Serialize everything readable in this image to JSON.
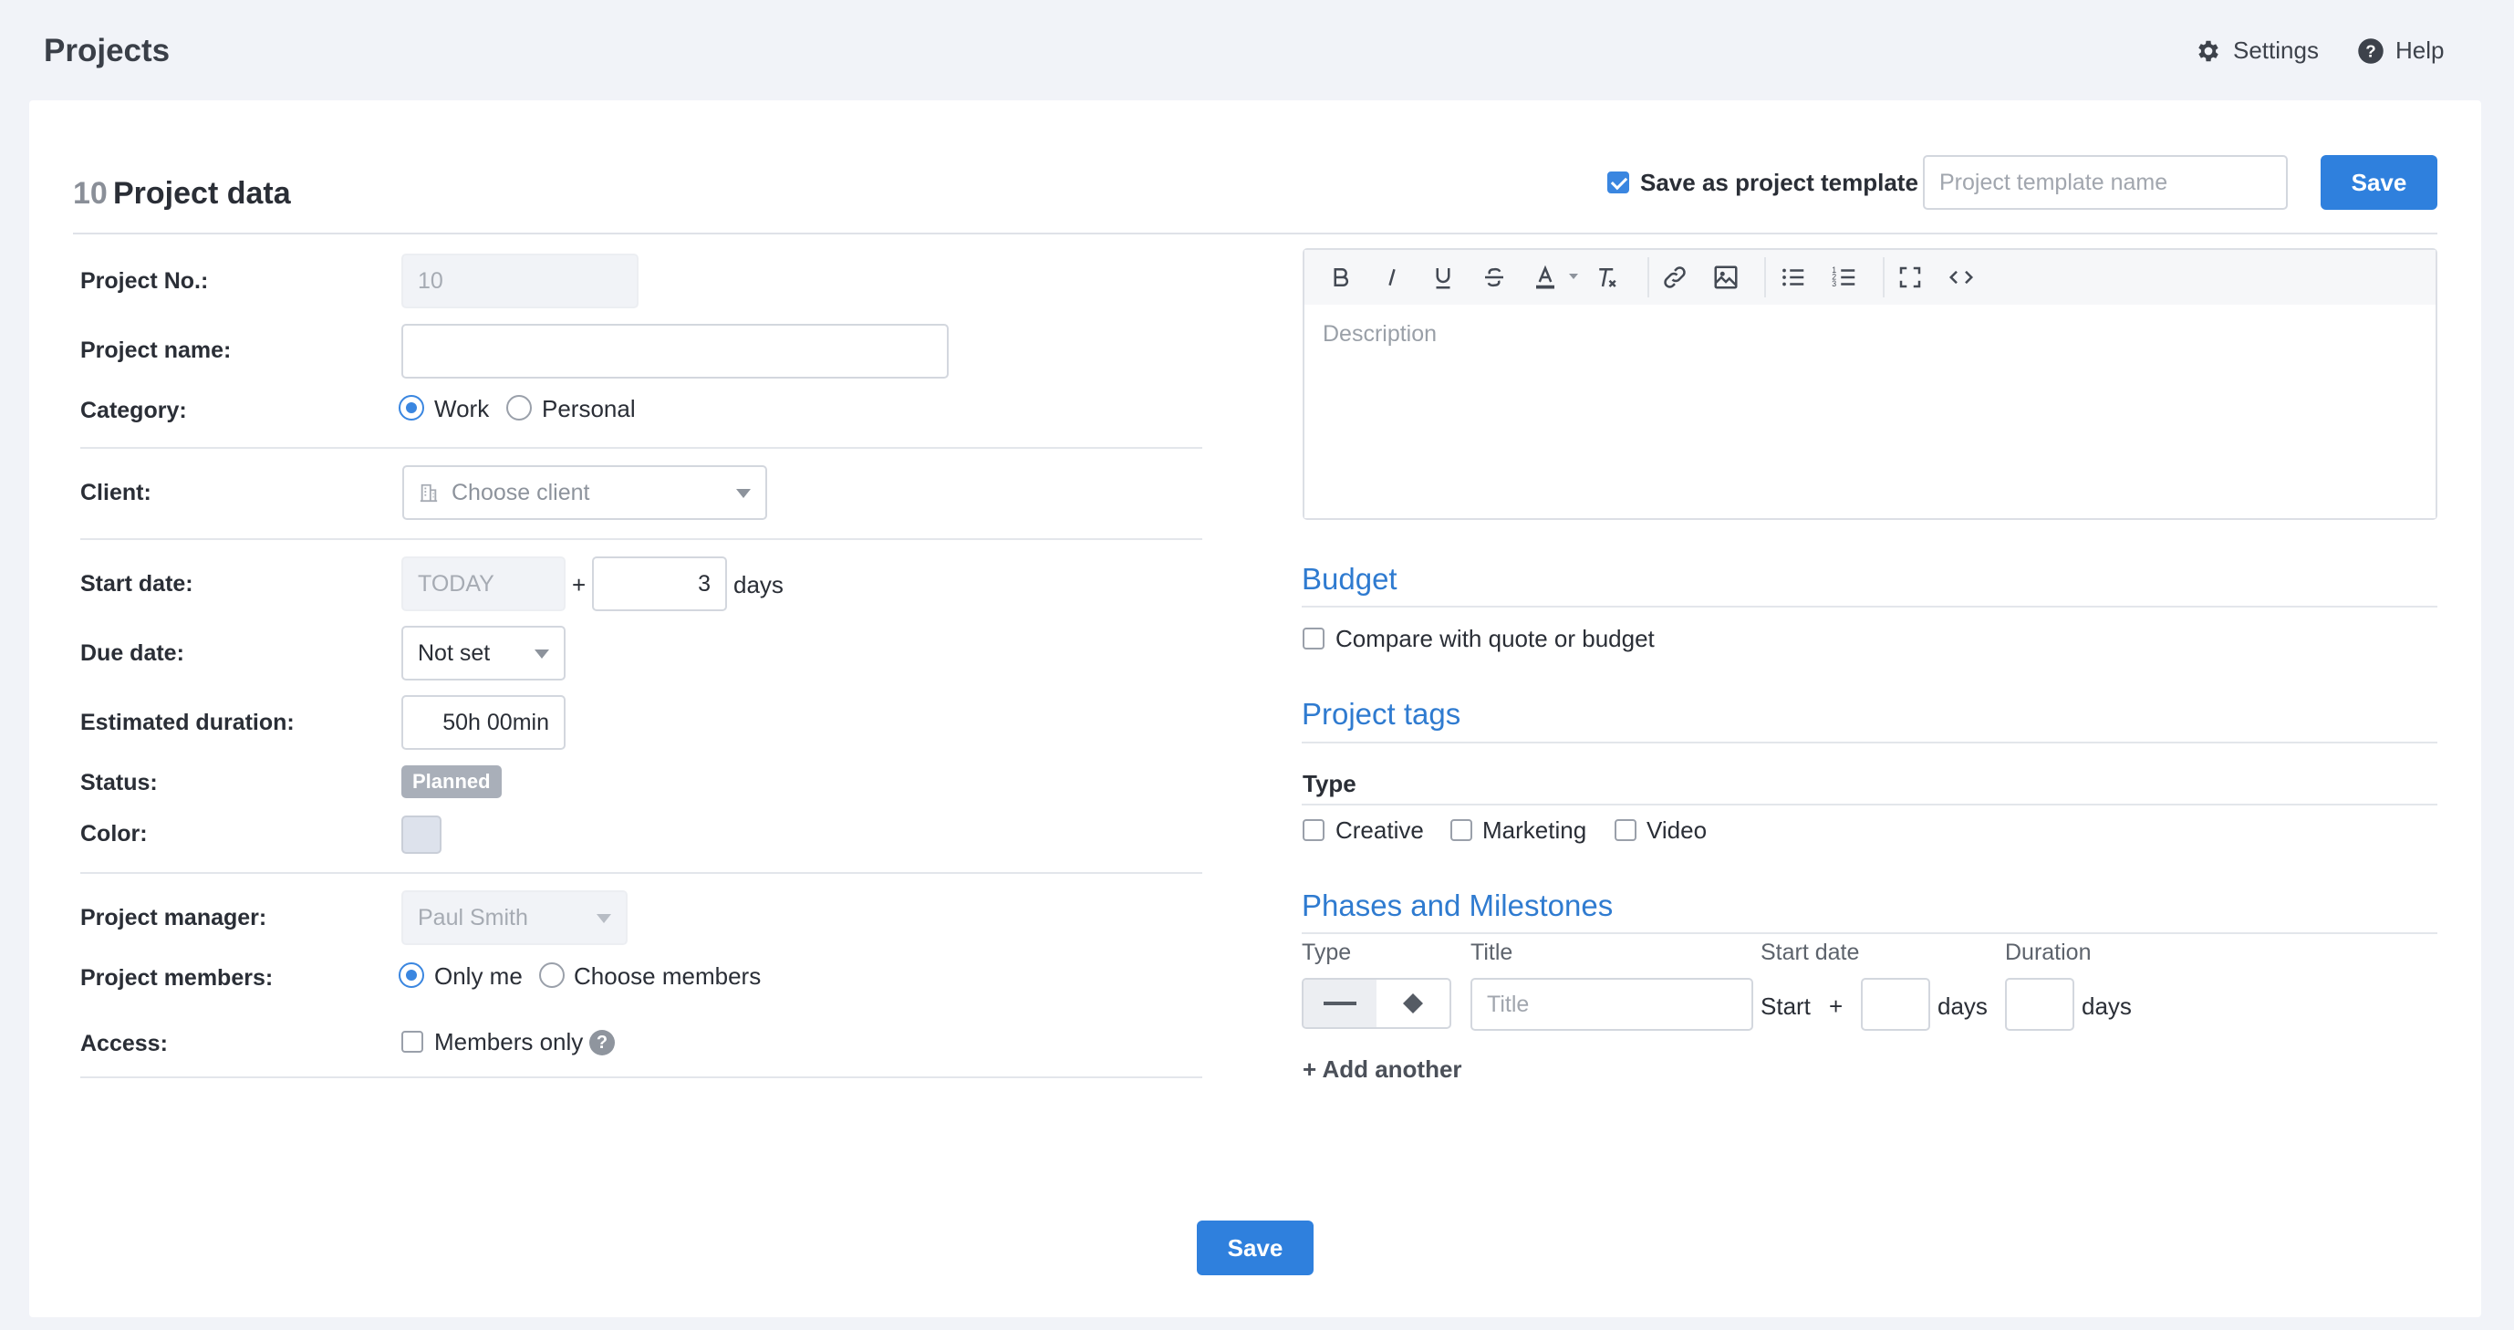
{
  "app": {
    "title": "Projects",
    "settings_label": "Settings",
    "help_label": "Help"
  },
  "header": {
    "count": "10",
    "title": "Project data",
    "save_template_label": "Save as project template",
    "save_template_checked": true,
    "template_name_placeholder": "Project template name",
    "save_label": "Save"
  },
  "form": {
    "project_no": {
      "label": "Project No.:",
      "value": "10"
    },
    "project_name": {
      "label": "Project name:",
      "value": ""
    },
    "category": {
      "label": "Category:",
      "options": [
        "Work",
        "Personal"
      ],
      "selected": "Work"
    },
    "client": {
      "label": "Client:",
      "placeholder": "Choose client",
      "icon": "building-icon"
    },
    "start_date": {
      "label": "Start date:",
      "base": "TODAY",
      "plus": "+",
      "offset": "3",
      "unit": "days"
    },
    "due_date": {
      "label": "Due date:",
      "value": "Not set"
    },
    "estimated_duration": {
      "label": "Estimated duration:",
      "value": "50h 00min"
    },
    "status": {
      "label": "Status:",
      "value": "Planned"
    },
    "color": {
      "label": "Color:",
      "value": "#dde2ec"
    },
    "project_manager": {
      "label": "Project manager:",
      "value": "Paul Smith"
    },
    "project_members": {
      "label": "Project members:",
      "options": [
        "Only me",
        "Choose members"
      ],
      "selected": "Only me"
    },
    "access": {
      "label": "Access:",
      "option": "Members only",
      "checked": false,
      "help": "?"
    }
  },
  "description": {
    "placeholder": "Description",
    "toolbar": [
      "bold-icon",
      "italic-icon",
      "underline-icon",
      "strikethrough-icon",
      "text-color-icon",
      "clear-format-icon",
      "link-icon",
      "image-icon",
      "bullet-list-icon",
      "numbered-list-icon",
      "fullscreen-icon",
      "code-view-icon"
    ]
  },
  "budget": {
    "title": "Budget",
    "compare_label": "Compare with quote or budget",
    "compare_checked": false
  },
  "tags": {
    "title": "Project tags",
    "type_label": "Type",
    "options": [
      {
        "label": "Creative",
        "checked": false
      },
      {
        "label": "Marketing",
        "checked": false
      },
      {
        "label": "Video",
        "checked": false
      }
    ]
  },
  "phases": {
    "title": "Phases and Milestones",
    "col_type": "Type",
    "col_title": "Title",
    "col_start": "Start date",
    "col_duration": "Duration",
    "title_placeholder": "Title",
    "start_text": "Start",
    "plus": "+",
    "days1": "days",
    "days2": "days",
    "add_another": "+ Add another"
  },
  "footer": {
    "save_label": "Save"
  },
  "colors": {
    "accent": "#2f80dd",
    "section_title": "#2f7bd0",
    "badge": "#a9afb9"
  }
}
